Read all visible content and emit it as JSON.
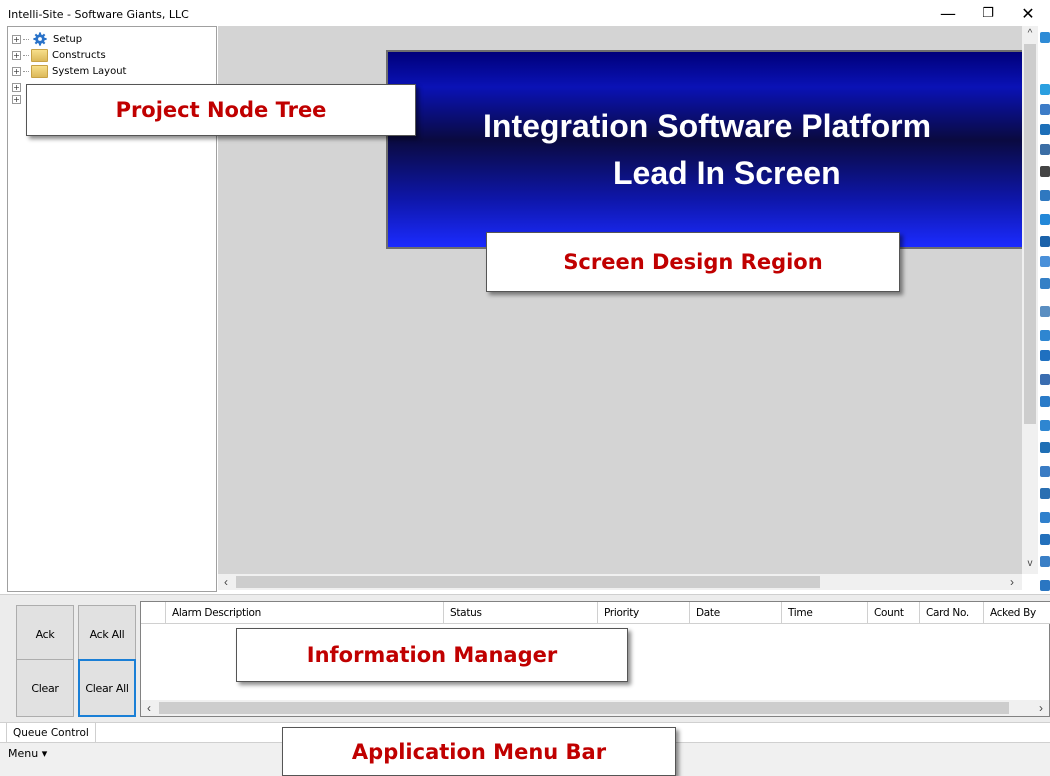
{
  "window": {
    "title": "Intelli-Site - Software Giants, LLC",
    "minimize_glyph": "—",
    "restore_glyph": "❐",
    "close_glyph": "✕"
  },
  "tree": {
    "expander_glyph": "+",
    "items": [
      {
        "label": "Setup",
        "icon": "gear-icon"
      },
      {
        "label": "Constructs",
        "icon": "folder-icon"
      },
      {
        "label": "System Layout",
        "icon": "folder-icon"
      }
    ]
  },
  "design": {
    "screen_line1": "Integration Software Platform",
    "screen_line2": "Lead In Screen"
  },
  "queue": {
    "ack": "Ack",
    "ack_all": "Ack All",
    "clear": "Clear",
    "clear_all": "Clear All",
    "columns": [
      "Alarm Description",
      "Status",
      "Priority",
      "Date",
      "Time",
      "Count",
      "Card No.",
      "Acked By"
    ]
  },
  "tabs": {
    "queue_control": "Queue Control"
  },
  "menubar": {
    "menu": "Menu ▾"
  },
  "callouts": {
    "project_node_tree": "Project Node Tree",
    "screen_design_region": "Screen Design Region",
    "information_manager": "Information Manager",
    "application_menu_bar": "Application Menu Bar"
  },
  "colors": {
    "callout_text": "#c00000",
    "focus_border": "#1a7fd6",
    "design_background": "#d4d4d4"
  }
}
